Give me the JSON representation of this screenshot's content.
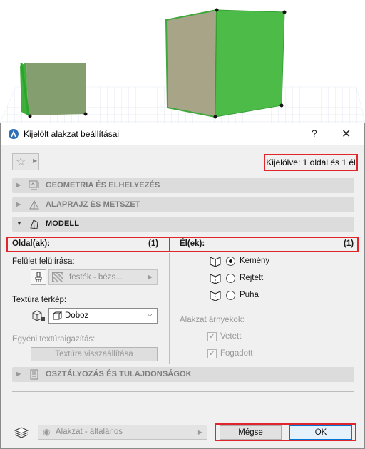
{
  "dialog": {
    "title": "Kijelölt alakzat beállításai",
    "help_label": "?",
    "close_label": "✕",
    "selection_info": "Kijelölve: 1 oldal és 1 él"
  },
  "panels": {
    "geometry": "GEOMETRIA ÉS ELHELYEZÉS",
    "floorplan": "ALAPRAJZ ÉS METSZET",
    "model": "MODELL",
    "classification": "OSZTÁLYOZÁS ÉS TULAJDONSÁGOK"
  },
  "faces": {
    "header": "Oldal(ak):",
    "count": "(1)",
    "surface_override_label": "Felület felülírása:",
    "surface_value": "festék - bézs...",
    "texture_map_label": "Textúra térkép:",
    "texture_map_value": "Doboz",
    "custom_texture_label": "Egyéni textúraigazítás:",
    "reset_texture_button": "Textúra visszaállítása"
  },
  "edges": {
    "header": "Él(ek):",
    "count": "(1)",
    "options": [
      {
        "label": "Kemény",
        "selected": true,
        "icon": "hard-edge-icon"
      },
      {
        "label": "Rejtett",
        "selected": false,
        "icon": "hidden-edge-icon"
      },
      {
        "label": "Puha",
        "selected": false,
        "icon": "soft-edge-icon"
      }
    ],
    "shadows_label": "Alakzat árnyékok:",
    "cast_label": "Vetett",
    "cast_checked": true,
    "received_label": "Fogadott",
    "received_checked": true
  },
  "footer": {
    "layer_value": "Alakzat - általános",
    "cancel_label": "Mégse",
    "ok_label": "OK"
  },
  "colors": {
    "highlight_red": "#e0262b",
    "cube_green": "#43b83f",
    "ok_border": "#0078d7"
  }
}
